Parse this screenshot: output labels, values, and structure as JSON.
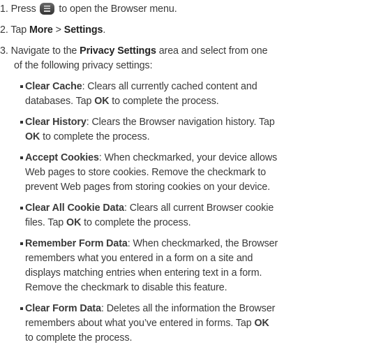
{
  "steps": [
    {
      "num": "1.",
      "pre": "Press",
      "icon": "menu-key-icon",
      "post": "to open the Browser menu."
    },
    {
      "num": "2.",
      "pre": "Tap",
      "bold1": "More",
      "sep": ">",
      "bold2": "Settings",
      "post": "."
    },
    {
      "num": "3.",
      "line1_pre": "Navigate to the",
      "line1_bold": "Privacy Settings",
      "line1_post": "area and select from one",
      "line2": "of the following privacy settings:"
    }
  ],
  "items": [
    {
      "title": "Clear Cache",
      "lines": [
        ": Clears all currently cached content and",
        "databases. Tap ",
        "OK",
        " to complete the process."
      ]
    },
    {
      "title": "Clear History",
      "lines": [
        ": Clears the Browser navigation history. Tap",
        "OK",
        " to complete the process."
      ]
    },
    {
      "title": "Accept Cookies",
      "lines": [
        ": When checkmarked, your device allows",
        "Web pages to store cookies. Remove the checkmark to",
        "prevent Web pages from storing cookies on your device."
      ]
    },
    {
      "title": "Clear All Cookie Data",
      "lines": [
        ": Clears all current Browser cookie",
        "files. Tap ",
        "OK",
        " to complete the process."
      ]
    },
    {
      "title": "Remember Form Data",
      "lines": [
        ": When checkmarked, the Browser",
        "remembers what you entered in a form on a site and",
        "displays matching entries when entering text in a form.",
        "Remove the checkmark to disable this feature."
      ]
    },
    {
      "title": "Clear Form Data",
      "lines": [
        ": Deletes all the information the Browser",
        "remembers about what you’ve entered in forms. Tap ",
        "OK",
        "to complete the process."
      ]
    }
  ]
}
